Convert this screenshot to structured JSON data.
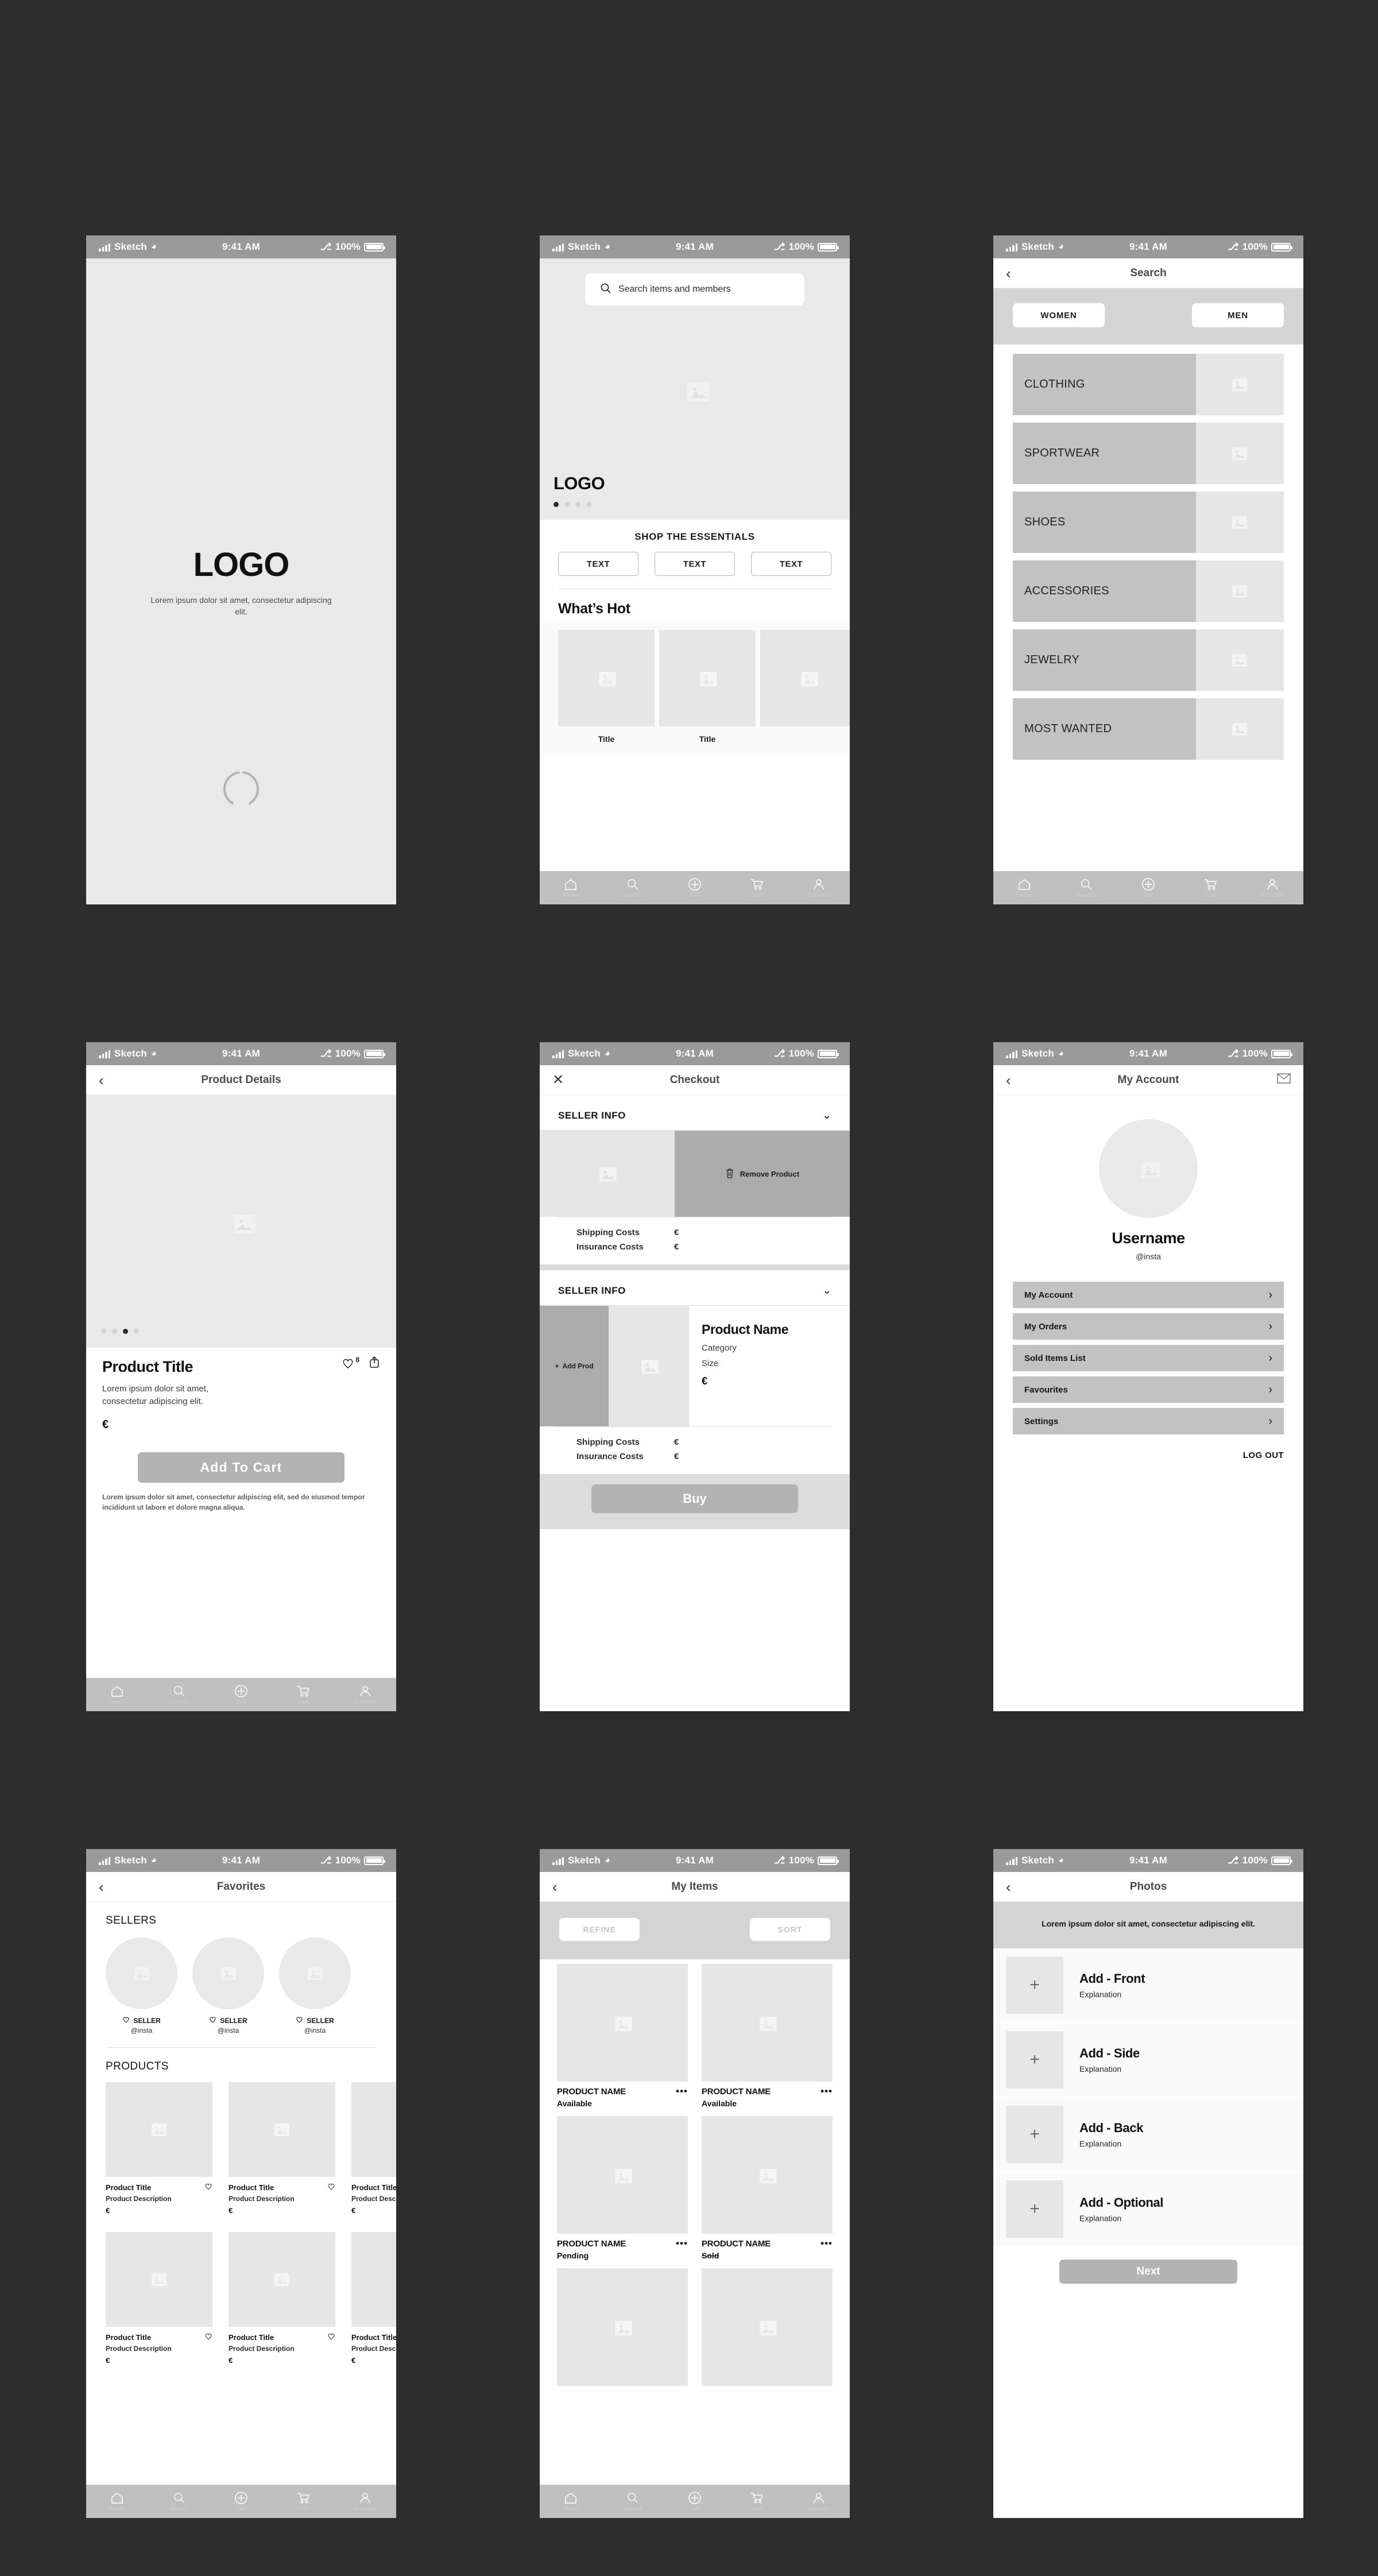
{
  "status_bar": {
    "carrier": "Sketch",
    "time": "9:41 AM",
    "battery": "100%"
  },
  "tab_bar": {
    "items": [
      {
        "icon": "home-icon",
        "label": "Home"
      },
      {
        "icon": "search-icon",
        "label": "Search"
      },
      {
        "icon": "plus-circle-icon",
        "label": "Sell"
      },
      {
        "icon": "cart-icon",
        "label": "Cart"
      },
      {
        "icon": "person-icon",
        "label": "Account"
      }
    ]
  },
  "splash": {
    "logo": "LOGO",
    "tagline": "Lorem ipsum dolor sit amet, consectetur adipiscing elit."
  },
  "home": {
    "search_placeholder": "Search items and members",
    "logo": "LOGO",
    "carousel_dots": 4,
    "carousel_active": 0,
    "essentials_title": "SHOP THE ESSENTIALS",
    "chips": [
      "TEXT",
      "TEXT",
      "TEXT"
    ],
    "hot_title": "What’s Hot",
    "hot_cards": [
      {
        "caption": "Title"
      },
      {
        "caption": "Title"
      },
      {
        "caption": ""
      }
    ]
  },
  "search": {
    "title": "Search",
    "segments": [
      "WOMEN",
      "MEN"
    ],
    "categories": [
      "CLOTHING",
      "SPORTWEAR",
      "SHOES",
      "ACCESSORIES",
      "JEWELRY",
      "MOST WANTED"
    ]
  },
  "product_details": {
    "title": "Product Details",
    "carousel_dots": 4,
    "carousel_active": 2,
    "like_count": "8",
    "product_title": "Product Title",
    "description": "Lorem ipsum dolor sit amet, consectetur adipiscing elit.",
    "price": "€",
    "cta": "Add To Cart",
    "fine_print": "Lorem ipsum dolor sit amet, consectetur adipiscing elit, sed do eiusmod tempor incididunt ut labore et dolore magna aliqua."
  },
  "checkout": {
    "title": "Checkout",
    "close_icon": "close-icon",
    "section_1": {
      "header": "SELLER INFO",
      "remove_label": "Remove Product",
      "shipping_label": "Shipping Costs",
      "shipping_value": "€",
      "insurance_label": "Insurance Costs",
      "insurance_value": "€"
    },
    "section_2": {
      "header": "SELLER INFO",
      "add_product_label": "Add Prod",
      "product_name": "Product Name",
      "category": "Category",
      "size": "Size",
      "price": "€",
      "shipping_label": "Shipping Costs",
      "shipping_value": "€",
      "insurance_label": "Insurance Costs",
      "insurance_value": "€"
    },
    "buy_label": "Buy"
  },
  "account": {
    "title": "My Account",
    "mail_icon": "envelope-icon",
    "username": "Username",
    "handle": "@insta",
    "menu": [
      "My Account",
      "My Orders",
      "Sold Items List",
      "Favourites",
      "Settings"
    ],
    "logout": "LOG OUT"
  },
  "favorites": {
    "title": "Favorites",
    "sellers_header": "SELLERS",
    "sellers": [
      {
        "name": "SELLER",
        "handle": "@insta"
      },
      {
        "name": "SELLER",
        "handle": "@insta"
      },
      {
        "name": "SELLER",
        "handle": "@insta"
      }
    ],
    "products_header": "PRODUCTS",
    "products": [
      {
        "title": "Product Title",
        "description": "Product Description",
        "price": "€"
      },
      {
        "title": "Product Title",
        "description": "Product Description",
        "price": "€"
      },
      {
        "title": "Product Title",
        "description": "Product Description",
        "price": "€"
      },
      {
        "title": "Product Title",
        "description": "Product Description",
        "price": "€"
      },
      {
        "title": "Product Title",
        "description": "Product Description",
        "price": "€"
      },
      {
        "title": "Product Title",
        "description": "Product Description",
        "price": "€"
      }
    ]
  },
  "my_items": {
    "title": "My Items",
    "refine_label": "REFINE",
    "sort_label": "SORT",
    "items": [
      {
        "name": "PRODUCT NAME",
        "status": "Available",
        "struck": false
      },
      {
        "name": "PRODUCT NAME",
        "status": "Available",
        "struck": false
      },
      {
        "name": "PRODUCT NAME",
        "status": "Pending",
        "struck": false
      },
      {
        "name": "PRODUCT NAME",
        "status": "Sold",
        "struck": true
      }
    ],
    "more_icon": "•••"
  },
  "photos": {
    "title": "Photos",
    "banner": "Lorem ipsum dolor sit amet, consectetur adipiscing elit.",
    "rows": [
      {
        "title": "Add - Front",
        "explanation": "Explanation"
      },
      {
        "title": "Add - Side",
        "explanation": "Explanation"
      },
      {
        "title": "Add - Back",
        "explanation": "Explanation"
      },
      {
        "title": "Add - Optional",
        "explanation": "Explanation"
      }
    ],
    "next_label": "Next"
  },
  "colors": {
    "canvas": "#2d2d2d",
    "placeholder": "#e6e6e6",
    "accent_gray": "#b3b3b3",
    "tabbar": "#c0c0c0"
  }
}
